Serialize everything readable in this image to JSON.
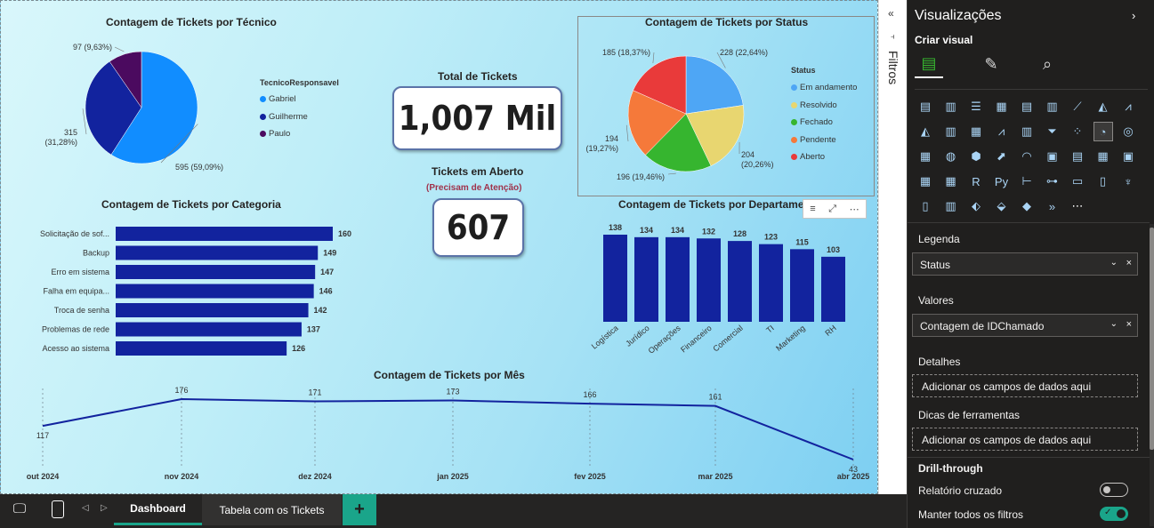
{
  "report": {
    "pie_tecnico": {
      "title": "Contagem de Tickets por Técnico",
      "legend_title": "TecnicoResponsavel",
      "slices": [
        {
          "name": "Gabriel",
          "value": 595,
          "label": "595 (59,09%)",
          "color": "#118dff"
        },
        {
          "name": "Guilherme",
          "value": 315,
          "label": "315 (31,28%)",
          "color": "#12239e"
        },
        {
          "name": "Paulo",
          "value": 97,
          "label": "97 (9,63%)",
          "color": "#4b0a5f"
        }
      ]
    },
    "kpi_total": {
      "title": "Total de Tickets",
      "value": "1,007 Mil"
    },
    "kpi_aberto": {
      "title": "Tickets em Aberto",
      "subtitle": "(Precisam de Atenção)",
      "value": "607"
    },
    "pie_status": {
      "title": "Contagem de Tickets por Status",
      "legend_title": "Status",
      "slices": [
        {
          "name": "Em andamento",
          "value": 228,
          "label": "228 (22,64%)",
          "color": "#4ea6f5"
        },
        {
          "name": "Resolvido",
          "value": 204,
          "label": "204 (20,26%)",
          "color": "#e8d670"
        },
        {
          "name": "Fechado",
          "value": 196,
          "label": "196 (19,46%)",
          "color": "#36b52f"
        },
        {
          "name": "Pendente",
          "value": 194,
          "label": "194 (19,27%)",
          "color": "#f5793a"
        },
        {
          "name": "Aberto",
          "value": 185,
          "label": "185 (18,37%)",
          "color": "#e93a3a"
        }
      ]
    },
    "bar_categoria": {
      "title": "Contagem de Tickets por Categoria",
      "categories": [
        "Solicitação de sof...",
        "Backup",
        "Erro em sistema",
        "Falha em equipa...",
        "Troca de senha",
        "Problemas de rede",
        "Acesso ao sistema"
      ],
      "values": [
        160,
        149,
        147,
        146,
        142,
        137,
        126
      ]
    },
    "col_departamento": {
      "title": "Contagem de Tickets por Departamento",
      "categories": [
        "Logística",
        "Jurídico",
        "Operações",
        "Financeiro",
        "Comercial",
        "TI",
        "Marketing",
        "RH"
      ],
      "values": [
        138,
        134,
        134,
        132,
        128,
        123,
        115,
        103
      ]
    },
    "line_mes": {
      "title": "Contagem de Tickets por Mês",
      "categories": [
        "out 2024",
        "nov 2024",
        "dez 2024",
        "jan 2025",
        "fev 2025",
        "mar 2025",
        "abr 2025"
      ],
      "values": [
        117,
        176,
        171,
        173,
        166,
        161,
        43
      ]
    }
  },
  "filters_pane": {
    "label": "Filtros"
  },
  "visualizations": {
    "title": "Visualizações",
    "subtitle": "Criar visual",
    "sections": {
      "legenda": "Legenda",
      "legenda_field": "Status",
      "valores": "Valores",
      "valores_field": "Contagem de IDChamado",
      "detalhes": "Detalhes",
      "detalhes_placeholder": "Adicionar os campos de dados aqui",
      "dicas": "Dicas de ferramentas",
      "dicas_placeholder": "Adicionar os campos de dados aqui",
      "drill_title": "Drill-through",
      "relatorio_cruzado": "Relatório cruzado",
      "manter_filtros": "Manter todos os filtros"
    }
  },
  "tabs": [
    "Dashboard",
    "Tabela com os Tickets"
  ],
  "colors": {
    "bar": "#12239e",
    "accent_tab": "#1aa58a",
    "toggle_on": "#1aa58a"
  },
  "chart_data": [
    {
      "type": "pie",
      "title": "Contagem de Tickets por Técnico",
      "categories": [
        "Gabriel",
        "Guilherme",
        "Paulo"
      ],
      "values": [
        595,
        315,
        97
      ],
      "legend": "right"
    },
    {
      "type": "pie",
      "title": "Contagem de Tickets por Status",
      "categories": [
        "Em andamento",
        "Resolvido",
        "Fechado",
        "Pendente",
        "Aberto"
      ],
      "values": [
        228,
        204,
        196,
        194,
        185
      ],
      "legend": "right"
    },
    {
      "type": "bar",
      "title": "Contagem de Tickets por Categoria",
      "categories": [
        "Solicitação de sof...",
        "Backup",
        "Erro em sistema",
        "Falha em equipa...",
        "Troca de senha",
        "Problemas de rede",
        "Acesso ao sistema"
      ],
      "values": [
        160,
        149,
        147,
        146,
        142,
        137,
        126
      ]
    },
    {
      "type": "bar",
      "title": "Contagem de Tickets por Departamento",
      "categories": [
        "Logística",
        "Jurídico",
        "Operações",
        "Financeiro",
        "Comercial",
        "TI",
        "Marketing",
        "RH"
      ],
      "values": [
        138,
        134,
        134,
        132,
        128,
        123,
        115,
        103
      ]
    },
    {
      "type": "line",
      "title": "Contagem de Tickets por Mês",
      "categories": [
        "out 2024",
        "nov 2024",
        "dez 2024",
        "jan 2025",
        "fev 2025",
        "mar 2025",
        "abr 2025"
      ],
      "values": [
        117,
        176,
        171,
        173,
        166,
        161,
        43
      ]
    }
  ]
}
